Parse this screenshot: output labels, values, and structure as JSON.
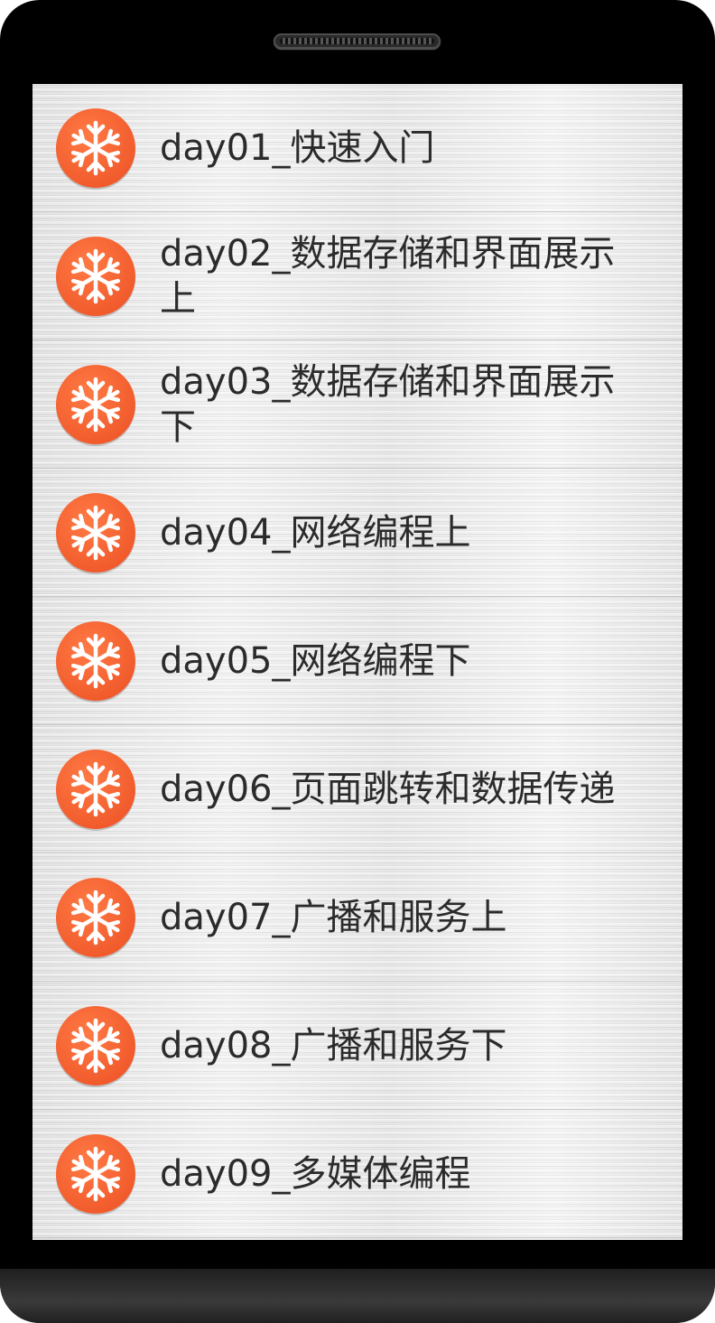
{
  "list": {
    "items": [
      {
        "label": "day01_快速入门",
        "icon": "snowflake-icon"
      },
      {
        "label": "day02_数据存储和界面展示上",
        "icon": "snowflake-icon"
      },
      {
        "label": "day03_数据存储和界面展示下",
        "icon": "snowflake-icon"
      },
      {
        "label": "day04_网络编程上",
        "icon": "snowflake-icon"
      },
      {
        "label": "day05_网络编程下",
        "icon": "snowflake-icon"
      },
      {
        "label": "day06_页面跳转和数据传递",
        "icon": "snowflake-icon"
      },
      {
        "label": "day07_广播和服务上",
        "icon": "snowflake-icon"
      },
      {
        "label": "day08_广播和服务下",
        "icon": "snowflake-icon"
      },
      {
        "label": "day09_多媒体编程",
        "icon": "snowflake-icon"
      }
    ]
  },
  "colors": {
    "icon_orange": "#f0582a",
    "text": "#2b2b2b",
    "frame": "#000000"
  }
}
